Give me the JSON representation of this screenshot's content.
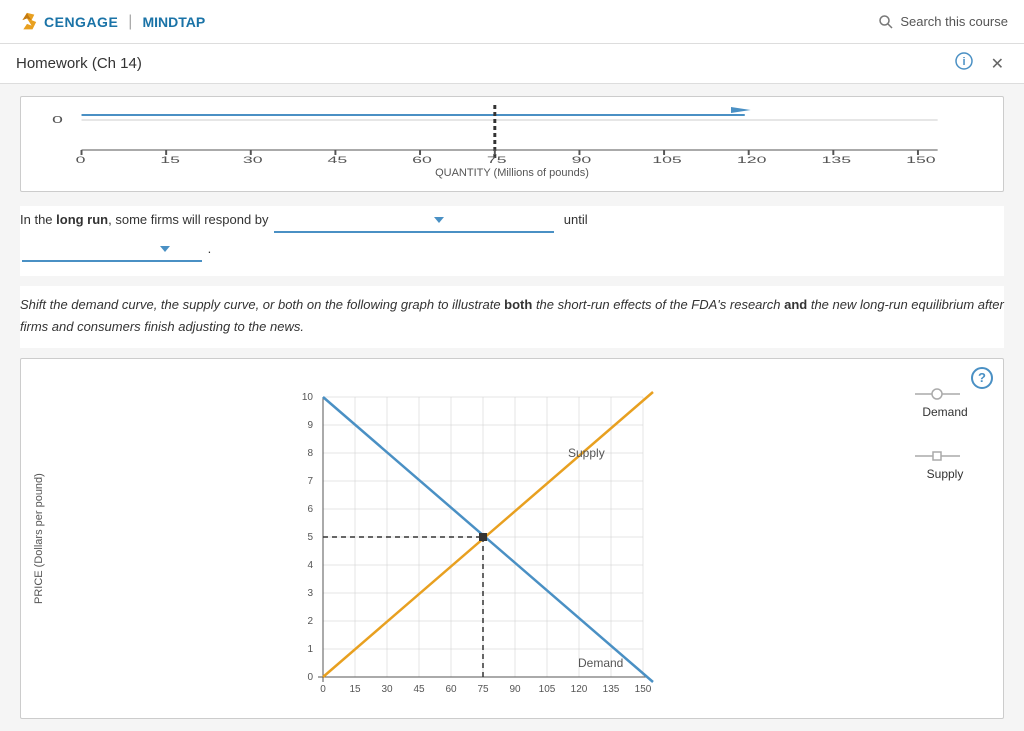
{
  "header": {
    "logo_cengage": "CENGAGE",
    "logo_divider": "|",
    "logo_mindtap": "MINDTAP",
    "search_placeholder": "Search this course"
  },
  "title_bar": {
    "title": "Homework (Ch 14)",
    "info_icon": "ℹ",
    "close_icon": "✕"
  },
  "mini_graph": {
    "x_axis_label": "QUANTITY (Millions of pounds)",
    "x_ticks": [
      "0",
      "15",
      "30",
      "45",
      "60",
      "75",
      "90",
      "105",
      "120",
      "135",
      "150"
    ],
    "y_value": "0"
  },
  "question_text": {
    "prefix": "In the ",
    "bold_term": "long run",
    "suffix1": ", some firms will respond by",
    "dropdown1_placeholder": "",
    "until_text": "until",
    "dropdown2_placeholder": "",
    "period": "."
  },
  "instruction": {
    "text_parts": [
      "Shift the demand curve, the supply curve, or both on the following graph to illustrate ",
      "both",
      " the short-run effects of the FDA’s research ",
      "and",
      " the new long-run equilibrium after firms and consumers finish adjusting to the news."
    ]
  },
  "main_graph": {
    "help_icon": "?",
    "y_axis_label": "PRICE (Dollars per pound)",
    "y_ticks": [
      "0",
      "1",
      "2",
      "3",
      "4",
      "5",
      "6",
      "7",
      "8",
      "9",
      "10"
    ],
    "x_axis_label": "",
    "x_ticks": [
      "0",
      "15",
      "30",
      "45",
      "60",
      "75",
      "90",
      "105",
      "120",
      "135",
      "150"
    ],
    "equilibrium_price": 5,
    "equilibrium_qty": 75,
    "demand_label": "Demand",
    "supply_label": "Supply",
    "legend": {
      "demand_label": "Demand",
      "supply_label": "Supply"
    }
  },
  "colors": {
    "blue": "#4a90c4",
    "orange": "#e8a020",
    "dashed": "#333",
    "header_bg": "#ffffff",
    "accent": "#1a73a7"
  }
}
